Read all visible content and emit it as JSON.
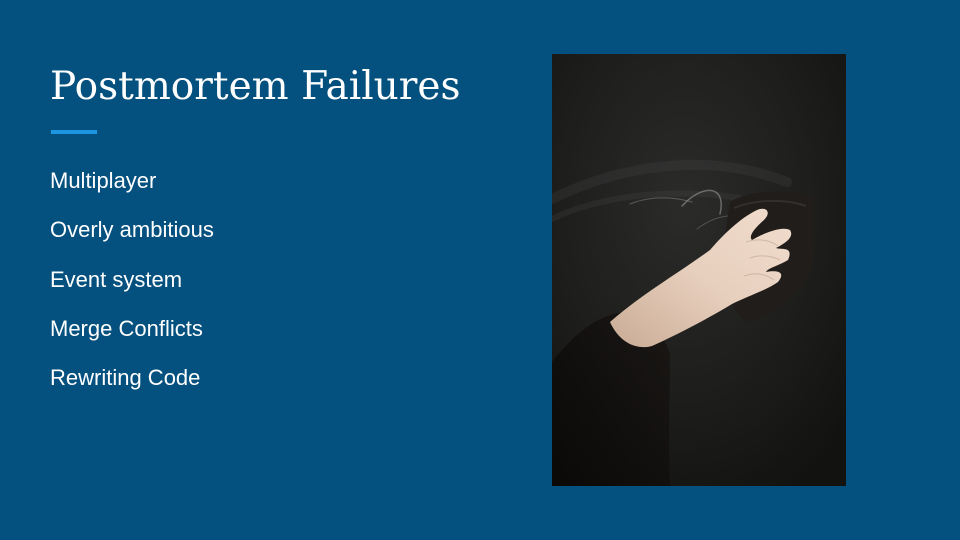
{
  "slide": {
    "title": "Postmortem Failures",
    "bullets": [
      "Multiplayer",
      "Overly ambitious",
      "Event system",
      "Merge Conflicts",
      "Rewriting Code"
    ],
    "photo": {
      "subject": "hand-wiping-chalkboard"
    }
  },
  "colors": {
    "background": "#04507e",
    "accent": "#1e95e0",
    "text": "#ffffff"
  }
}
